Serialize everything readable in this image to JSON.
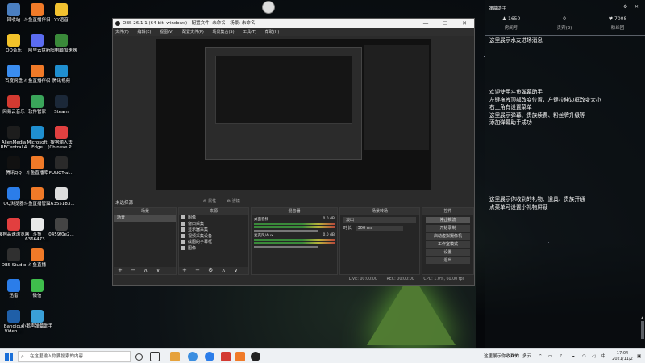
{
  "desktop": {
    "icons": [
      {
        "label": "回收站",
        "color": "#4a7fc1"
      },
      {
        "label": "QQ音乐",
        "color": "#f3c32a"
      },
      {
        "label": "百度网盘",
        "color": "#3a8df0"
      },
      {
        "label": "网易云音乐",
        "color": "#d33a31"
      },
      {
        "label": "AlienMedia RECentral 4",
        "color": "#1d1d1d"
      },
      {
        "label": "腾讯QQ",
        "color": "#111111"
      },
      {
        "label": "QQ浏览器",
        "color": "#2b7de9"
      },
      {
        "label": "搜狗高速浏览器",
        "color": "#e23f3f"
      },
      {
        "label": "OBS Studio",
        "color": "#303030"
      },
      {
        "label": "迅雷",
        "color": "#2b7de9"
      },
      {
        "label": "Bandicut Video ...",
        "color": "#1f5fa8"
      },
      {
        "label": "斗鱼直播伴侣",
        "color": "#f07a28"
      },
      {
        "label": "阿里云盘",
        "color": "#5b6cf0"
      },
      {
        "label": "斗鱼直播伴侣",
        "color": "#f07a28"
      },
      {
        "label": "软件管家",
        "color": "#3aa55a"
      },
      {
        "label": "Microsoft Edge",
        "color": "#1f8fd0"
      },
      {
        "label": "斗鱼直播库",
        "color": "#f07a28"
      },
      {
        "label": "斗鱼直播管家",
        "color": "#f07a28"
      },
      {
        "label": "斗鱼 6366473...",
        "color": "#e8e8e8"
      },
      {
        "label": "斗鱼直播",
        "color": "#f07a28"
      },
      {
        "label": "微信",
        "color": "#3fbe4c"
      },
      {
        "label": "小鹅声弹幕助手",
        "color": "#3aa0d8"
      },
      {
        "label": "YY语音",
        "color": "#f2c230"
      },
      {
        "label": "新阳电脑加速器",
        "color": "#3a8a3a"
      },
      {
        "label": "腾讯视频",
        "color": "#1f8fd0"
      },
      {
        "label": "Steam",
        "color": "#1b2838"
      },
      {
        "label": "搜狗输入法 (Chinese P...",
        "color": "#e04040"
      },
      {
        "label": "FUNGTrai...",
        "color": "#2a2a2a"
      },
      {
        "label": "16355183...",
        "color": "#dddddd"
      },
      {
        "label": "0459f0e2...",
        "color": "#444444"
      }
    ]
  },
  "obs": {
    "title": "OBS 26.1.1 (64-bit, windows) - 配置文件: 未命名 - 场景: 未命名",
    "menu": [
      "文件(F)",
      "编辑(E)",
      "视图(V)",
      "配置文件(P)",
      "场景集合(S)",
      "工具(T)",
      "帮助(H)"
    ],
    "window_controls": {
      "minimize": "—",
      "maximize": "☐",
      "close": "✕"
    },
    "scene_label": "未选择源",
    "preview_tools": [
      "⚙ 属性",
      "⚙ 滤镜"
    ],
    "docks": {
      "scenes": {
        "title": "场景",
        "items": [
          "场景"
        ]
      },
      "sources": {
        "title": "来源",
        "items": [
          "图像",
          "窗口采集",
          "显示器采集",
          "视频采集设备",
          "截图的字幕框",
          "图像"
        ]
      },
      "mixer": {
        "title": "混音器",
        "tracks": [
          {
            "name": "桌面音频",
            "level": "0.0 dB"
          },
          {
            "name": "麦克风/Aux",
            "level": "0.0 dB"
          }
        ]
      },
      "transitions": {
        "title": "场景转场",
        "type": "淡出",
        "duration_label": "时长",
        "duration": "300 ms"
      },
      "controls": {
        "title": "控件",
        "buttons": [
          "停止推流",
          "开始录制",
          "启动虚拟摄像机",
          "工作室模式",
          "设置",
          "退出"
        ]
      }
    },
    "footer_icons": "+ − ∧ ∨",
    "footer_icons_src": "+ − ⚙ ∧ ∨",
    "status": {
      "live": "LIVE: 00:00:00",
      "rec": "REC: 00:00:00",
      "cpu": "CPU: 1.0%, 60.00 fps"
    }
  },
  "panel": {
    "title": "弹幕助手",
    "stats": [
      {
        "value": "1650",
        "label": "房间号"
      },
      {
        "value": "0",
        "label": "贵宾(3)"
      },
      {
        "value": "7008",
        "label": "粉丝团"
      }
    ],
    "messages": [
      "这里展示水友进场消息",
      "欢迎使用斗鱼弹幕助手\n左键拖拽顶部改变位置，左键拉伸边框改变大小\n右上角有设置菜单\n这里展示弹幕、贵族续费、粉丝牌升级等\n添加弹幕助手成功",
      "这里展示你收到的礼物、道具、贵族开通\n点菜单可设置小礼物屏蔽"
    ]
  },
  "taskbar": {
    "search_placeholder": "在这里输入你要搜索的内容",
    "tray_text": "这里展示你收到的",
    "weather": "20°C",
    "weather_desc": "多云",
    "ime": "中",
    "time": "17:04",
    "date": "2021/11/2"
  }
}
